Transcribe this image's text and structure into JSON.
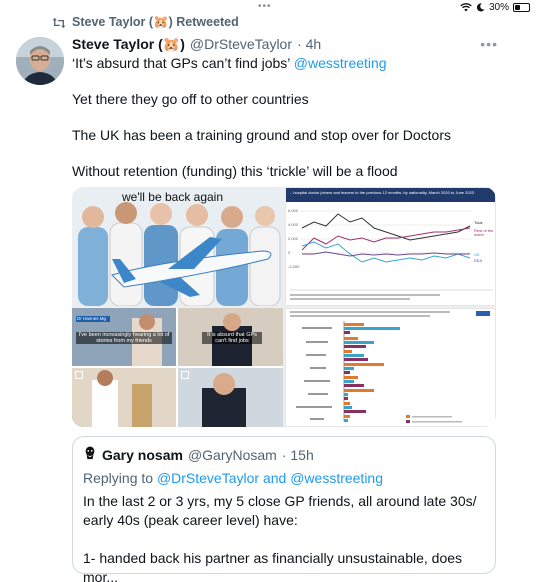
{
  "status_bar": {
    "battery": "30%",
    "battery_level": 0.3,
    "icons": [
      "wifi-icon",
      "moon-icon",
      "battery-icon"
    ]
  },
  "retweet": {
    "label": "Steve Taylor (🐹) Retweeted"
  },
  "tweet": {
    "author_name": "Steve Taylor (🐹)",
    "author_handle": "@DrSteveTaylor",
    "time": "· 4h",
    "line1_text": "‘It’s absurd that GPs can’t find jobs’ ",
    "line1_mention": "@wesstreeting",
    "line2": "Yet there they go off to other countries",
    "line3": "The UK has been a training ground and stop over for Doctors",
    "line4": "Without retention (funding) this ‘trickle’ will be a flood"
  },
  "media": {
    "image1_caption": "we'll be back again",
    "image3_name_tag": "Dr Hannes Mg",
    "image3_subtitle": "I've been increasingly hearing a lot of stories from my friends",
    "image4_subtitle": "It is absurd that GPs can't find jobs",
    "chart_top_title": "...hospital doctor joiners and leavers to the previous 12 months, by nationality, March 2020 to June 2023",
    "chart_top_legend": [
      "Total",
      "Rest of the world",
      "UK",
      "EEA"
    ]
  },
  "quote": {
    "author_name": "Gary nosam",
    "author_handle": "@GaryNosam",
    "time": "· 15h",
    "replying_prefix": "Replying to ",
    "replying_to": "@DrSteveTaylor and @wesstreeting",
    "para1": "In the last 2 or 3 yrs, my 5 close GP friends, all around late 30s/\nearly 40s (peak career level) have:",
    "para2": "1- handed back his partner as financially unsustainable, does mor..."
  },
  "colors": {
    "accent": "#1d9bf0",
    "secondary_text": "#536471",
    "border": "#cfd9de"
  }
}
